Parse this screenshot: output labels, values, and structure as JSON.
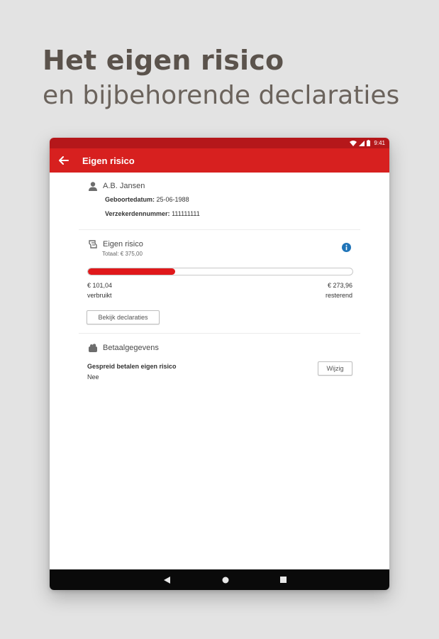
{
  "promo": {
    "headline": "Het eigen risico",
    "subheadline": "en bijbehorende declaraties"
  },
  "status_bar": {
    "time": "9:41",
    "icons": [
      "wifi-icon",
      "signal-icon",
      "battery-icon"
    ]
  },
  "app_bar": {
    "title": "Eigen risico",
    "back_icon": "arrow-left-icon"
  },
  "person": {
    "name": "A.B. Jansen",
    "birthdate_label": "Geboortedatum:",
    "birthdate_value": "25-06-1988",
    "insured_number_label": "Verzekerdennummer:",
    "insured_number_value": "111111111"
  },
  "deductible": {
    "title": "Eigen risico",
    "total": "Totaal: € 375,00",
    "info_icon": "info-icon",
    "progress_fraction": 0.33,
    "used_amount": "€ 101,04",
    "used_label": "verbruikt",
    "remaining_amount": "€ 273,96",
    "remaining_label": "resterend",
    "claims_button": "Bekijk declaraties"
  },
  "payment": {
    "title": "Betaalgegevens",
    "spread_label": "Gespreid betalen eigen risico",
    "spread_value": "Nee",
    "edit_button": "Wijzig"
  },
  "colors": {
    "status_bar": "#b5171a",
    "app_bar": "#d7201f",
    "progress": "#e0181b",
    "info": "#1f74b8"
  }
}
